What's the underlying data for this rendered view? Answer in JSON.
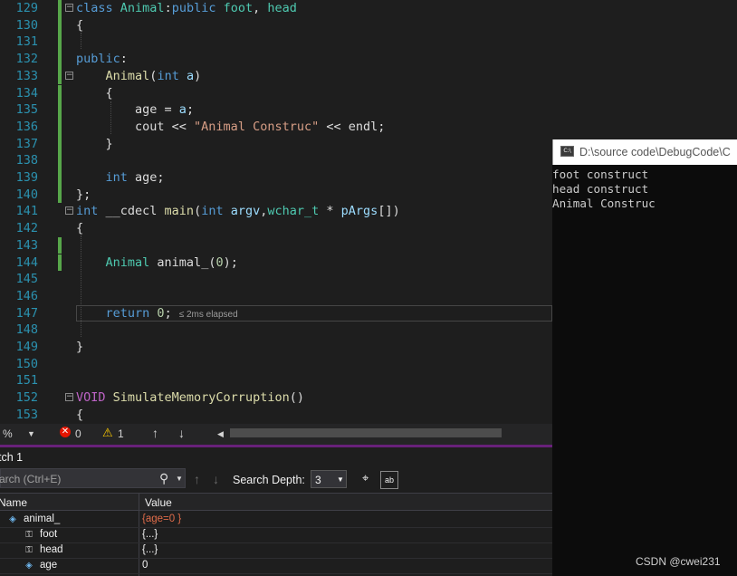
{
  "editor": {
    "lines": [
      {
        "n": "129",
        "tokens": [
          [
            "kw",
            "class "
          ],
          [
            "ty",
            "Animal"
          ],
          [
            "pl",
            ":"
          ],
          [
            "kw",
            "public "
          ],
          [
            "ty",
            "foot"
          ],
          [
            "pl",
            ", "
          ],
          [
            "ty",
            "head"
          ]
        ]
      },
      {
        "n": "130",
        "tokens": [
          [
            "pl",
            "{"
          ]
        ]
      },
      {
        "n": "131",
        "tokens": []
      },
      {
        "n": "132",
        "tokens": [
          [
            "kw",
            "public"
          ],
          [
            "pl",
            ":"
          ]
        ]
      },
      {
        "n": "133",
        "tokens": [
          [
            "pl",
            "    "
          ],
          [
            "fn",
            "Animal"
          ],
          [
            "pl",
            "("
          ],
          [
            "kw",
            "int "
          ],
          [
            "prm",
            "a"
          ],
          [
            "pl",
            ")"
          ]
        ]
      },
      {
        "n": "134",
        "tokens": [
          [
            "pl",
            "    {"
          ]
        ]
      },
      {
        "n": "135",
        "tokens": [
          [
            "pl",
            "        age = "
          ],
          [
            "prm",
            "a"
          ],
          [
            "pl",
            ";"
          ]
        ]
      },
      {
        "n": "136",
        "tokens": [
          [
            "pl",
            "        cout << "
          ],
          [
            "str",
            "\"Animal Construc\""
          ],
          [
            "pl",
            " << endl;"
          ]
        ]
      },
      {
        "n": "137",
        "tokens": [
          [
            "pl",
            "    }"
          ]
        ]
      },
      {
        "n": "138",
        "tokens": []
      },
      {
        "n": "139",
        "tokens": [
          [
            "pl",
            "    "
          ],
          [
            "kw",
            "int "
          ],
          [
            "pl",
            "age;"
          ]
        ]
      },
      {
        "n": "140",
        "tokens": [
          [
            "pl",
            "};"
          ]
        ]
      },
      {
        "n": "141",
        "tokens": [
          [
            "kw",
            "int "
          ],
          [
            "pl",
            "__cdecl "
          ],
          [
            "fn",
            "main"
          ],
          [
            "pl",
            "("
          ],
          [
            "kw",
            "int "
          ],
          [
            "prm",
            "argv"
          ],
          [
            "pl",
            ","
          ],
          [
            "ty",
            "wchar_t"
          ],
          [
            "pl",
            " * "
          ],
          [
            "prm",
            "pArgs"
          ],
          [
            "pl",
            "[])"
          ]
        ]
      },
      {
        "n": "142",
        "tokens": [
          [
            "pl",
            "{"
          ]
        ]
      },
      {
        "n": "143",
        "tokens": []
      },
      {
        "n": "144",
        "tokens": [
          [
            "pl",
            "    "
          ],
          [
            "ty",
            "Animal "
          ],
          [
            "pl",
            "animal_("
          ],
          [
            "num",
            "0"
          ],
          [
            "pl",
            ");"
          ]
        ]
      },
      {
        "n": "145",
        "tokens": []
      },
      {
        "n": "146",
        "tokens": []
      },
      {
        "n": "147",
        "tokens": [
          [
            "pl",
            "    "
          ],
          [
            "kw",
            "return "
          ],
          [
            "num",
            "0"
          ],
          [
            "pl",
            ";"
          ]
        ],
        "elapsed": "≤ 2ms elapsed"
      },
      {
        "n": "148",
        "tokens": []
      },
      {
        "n": "149",
        "tokens": [
          [
            "pl",
            "}"
          ]
        ]
      },
      {
        "n": "150",
        "tokens": []
      },
      {
        "n": "151",
        "tokens": []
      },
      {
        "n": "152",
        "tokens": [
          [
            "mac",
            "VOID "
          ],
          [
            "fn",
            "SimulateMemoryCorruption"
          ],
          [
            "pl",
            "()"
          ]
        ]
      },
      {
        "n": "153",
        "tokens": [
          [
            "pl",
            "{"
          ]
        ]
      }
    ]
  },
  "status": {
    "zoom": "%",
    "errors": "0",
    "warnings": "1"
  },
  "watch": {
    "title": "tch 1",
    "search_placeholder": "arch (Ctrl+E)",
    "search_depth_label": "Search Depth:",
    "search_depth_value": "3",
    "col_name": "Name",
    "col_value": "Value",
    "rows": [
      {
        "name": "animal_",
        "value": "{age=0 }",
        "icon": "variable-icon"
      },
      {
        "name": "foot",
        "value": "{...}",
        "icon": "base-class-icon"
      },
      {
        "name": "head",
        "value": "{...}",
        "icon": "base-class-icon"
      },
      {
        "name": "age",
        "value": "0",
        "icon": "field-icon"
      }
    ]
  },
  "console": {
    "title": "D:\\source code\\DebugCode\\C",
    "lines": [
      "foot construct",
      "head construct",
      "Animal Construc"
    ]
  },
  "watermark": "CSDN @cwei231",
  "colors": {
    "keyword": "#569cd6",
    "type": "#4ec9b0",
    "function": "#dcdcaa",
    "string": "#d69d85",
    "number": "#b5cea8",
    "param": "#9cdcfe",
    "accent": "#68217a",
    "changed": "#57a64a"
  }
}
